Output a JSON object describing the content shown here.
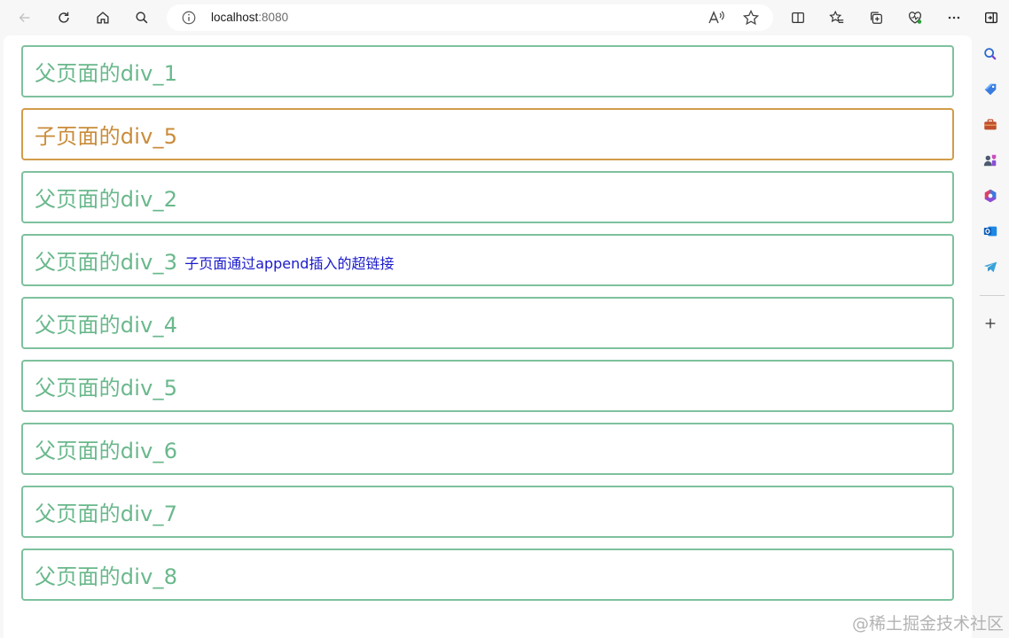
{
  "browser": {
    "address": {
      "host": "localhost",
      "port": ":8080"
    },
    "toolbar_icons": [
      "back-icon",
      "reload-icon",
      "home-icon",
      "search-icon",
      "info-icon",
      "read-aloud-icon",
      "favorite-star-icon",
      "split-screen-icon",
      "favorites-icon",
      "collections-icon",
      "performance-icon",
      "more-icon",
      "sidebar-toggle-icon"
    ],
    "sidebar_icons": [
      "search-icon",
      "shopping-tag-icon",
      "tools-icon",
      "games-icon",
      "office-icon",
      "outlook-icon",
      "telegram-icon",
      "add-icon"
    ]
  },
  "page": {
    "boxes": [
      {
        "label": "父页面的div_1",
        "kind": "parent",
        "link": ""
      },
      {
        "label": "子页面的div_5",
        "kind": "child",
        "link": ""
      },
      {
        "label": "父页面的div_2",
        "kind": "parent",
        "link": ""
      },
      {
        "label": "父页面的div_3",
        "kind": "parent",
        "link": "子页面通过append插入的超链接"
      },
      {
        "label": "父页面的div_4",
        "kind": "parent",
        "link": ""
      },
      {
        "label": "父页面的div_5",
        "kind": "parent",
        "link": ""
      },
      {
        "label": "父页面的div_6",
        "kind": "parent",
        "link": ""
      },
      {
        "label": "父页面的div_7",
        "kind": "parent",
        "link": ""
      },
      {
        "label": "父页面的div_8",
        "kind": "parent",
        "link": ""
      }
    ]
  },
  "watermark": "@稀土掘金技术社区",
  "colors": {
    "parent_border": "#7ec19d",
    "parent_text": "#6ab88c",
    "child_border": "#d29c4a",
    "child_text": "#c98c3a",
    "link": "#1a1acc"
  }
}
